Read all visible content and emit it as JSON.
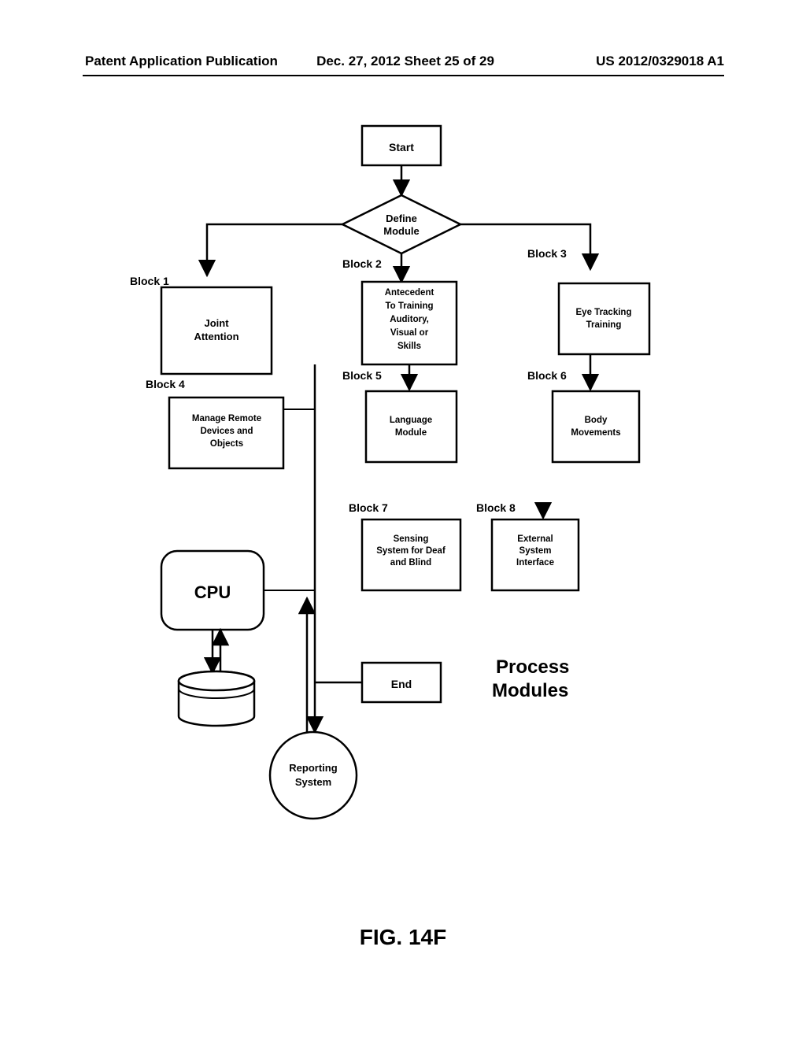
{
  "header": {
    "left": "Patent Application Publication",
    "mid": "Dec. 27, 2012   Sheet 25 of 29",
    "right": "US 2012/0329018 A1"
  },
  "nodes": {
    "start": "Start",
    "define1": "Define",
    "define2": "Module",
    "b1_label": "Block 1",
    "b2_label": "Block 2",
    "b3_label": "Block 3",
    "b4_label": "Block 4",
    "b5_label": "Block 5",
    "b6_label": "Block 6",
    "b7_label": "Block 7",
    "b8_label": "Block 8",
    "b1a": "Joint",
    "b1b": "Attention",
    "b2a": "Antecedent",
    "b2b": "To Training",
    "b2c": "Auditory,",
    "b2d": "Visual or",
    "b2e": "Skills",
    "b3a": "Eye Tracking",
    "b3b": "Training",
    "b4a": "Manage Remote",
    "b4b": "Devices and",
    "b4c": "Objects",
    "b5a": "Language",
    "b5b": "Module",
    "b6a": "Body",
    "b6b": "Movements",
    "b7a": "Sensing",
    "b7b": "System for Deaf",
    "b7c": "and Blind",
    "b8a": "External",
    "b8b": "System",
    "b8c": "Interface",
    "cpu": "CPU",
    "end": "End",
    "rep1": "Reporting",
    "rep2": "System",
    "title1": "Process",
    "title2": "Modules",
    "fig": "FIG. 14F"
  }
}
